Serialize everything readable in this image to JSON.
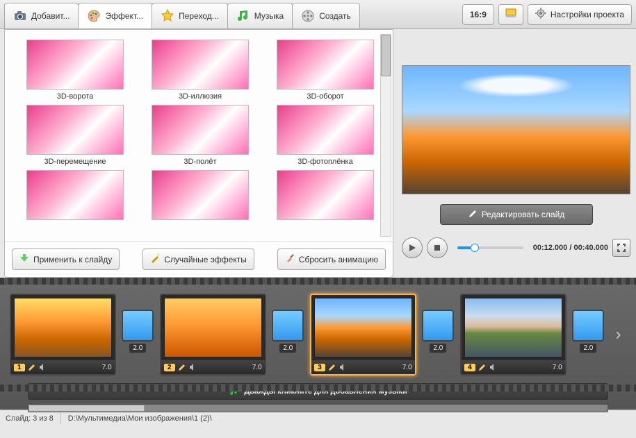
{
  "tabs": {
    "add": "Добавит...",
    "effects": "Эффект...",
    "transitions": "Переход...",
    "music": "Музыка",
    "create": "Создать"
  },
  "toolbar": {
    "aspect": "16:9",
    "settings": "Настройки проекта"
  },
  "effects": {
    "items": [
      "3D-ворота",
      "3D-иллюзия",
      "3D-оборот",
      "3D-перемещение",
      "3D-полёт",
      "3D-фотоплёнка"
    ],
    "apply": "Применить к слайду",
    "random": "Случайные эффекты",
    "reset": "Сбросить анимацию"
  },
  "preview": {
    "edit": "Редактировать слайд",
    "time_current": "00:12.000",
    "time_total": "00:40.000"
  },
  "timeline": {
    "slides": [
      {
        "n": "1",
        "dur": "7.0",
        "cls": "sv-autumn"
      },
      {
        "n": "2",
        "dur": "7.0",
        "cls": "sv-sunset"
      },
      {
        "n": "3",
        "dur": "7.0",
        "cls": "sv-forest",
        "selected": true
      },
      {
        "n": "4",
        "dur": "7.0",
        "cls": "sv-lake"
      }
    ],
    "trans_dur": "2.0",
    "music_hint": "Дважды кликните для добавления музыки"
  },
  "status": {
    "slide": "Слайд: 3 из 8",
    "path": "D:\\Мультимедиа\\Мои изображения\\1 (2)\\"
  }
}
